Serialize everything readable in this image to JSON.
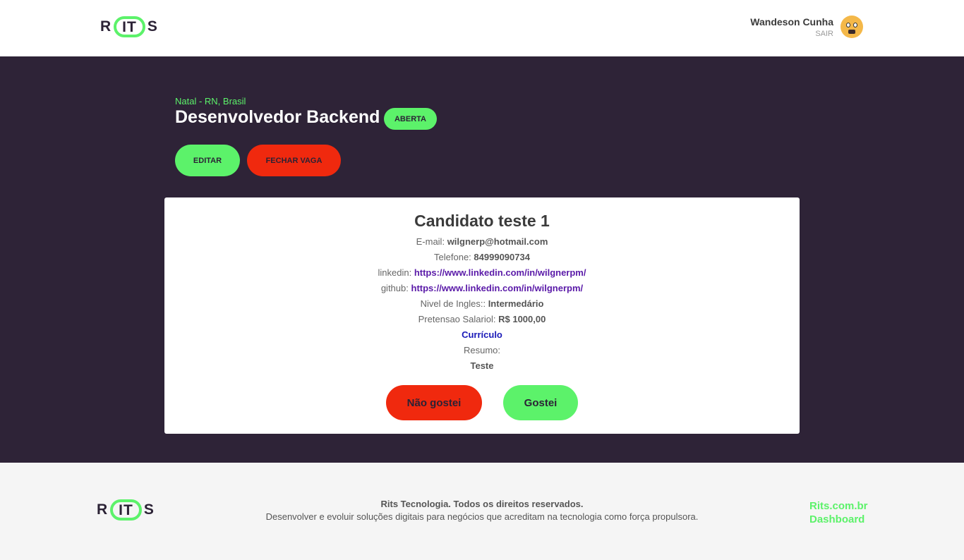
{
  "header": {
    "logo": {
      "left": "R",
      "middle": "IT",
      "right": "S"
    },
    "user": {
      "name": "Wandeson Cunha",
      "logout": "SAIR"
    }
  },
  "job": {
    "location": "Natal - RN, Brasil",
    "title": "Desenvolvedor Backend",
    "status": "ABERTA",
    "edit_label": "EDITAR",
    "close_label": "FECHAR VAGA"
  },
  "candidate": {
    "name": "Candidato teste 1",
    "email_label": "E-mail:",
    "email": "wilgnerp@hotmail.com",
    "phone_label": "Telefone:",
    "phone": "84999090734",
    "linkedin_label": "linkedin:",
    "linkedin": "https://www.linkedin.com/in/wilgnerpm/",
    "github_label": "github:",
    "github": "https://www.linkedin.com/in/wilgnerpm/",
    "english_label": "Nivel de Ingles::",
    "english": "Intermedário",
    "salary_label": "Pretensao Salariol:",
    "salary": "R$ 1000,00",
    "resume_link": "Currículo",
    "summary_label": "Resumo:",
    "summary": "Teste",
    "dislike_label": "Não gostei",
    "like_label": "Gostei"
  },
  "footer": {
    "logo": {
      "left": "R",
      "middle": "IT",
      "right": "S"
    },
    "copyright": "Rits Tecnologia. Todos os direitos reservados.",
    "description": "Desenvolver e evoluir soluções digitais para negócios que acreditam na tecnologia como força propulsora.",
    "links": [
      "Rits.com.br",
      "Dashboard"
    ]
  },
  "colors": {
    "accent_green": "#5cf26a",
    "danger_red": "#f0290e",
    "hero_bg": "#2e2337"
  }
}
